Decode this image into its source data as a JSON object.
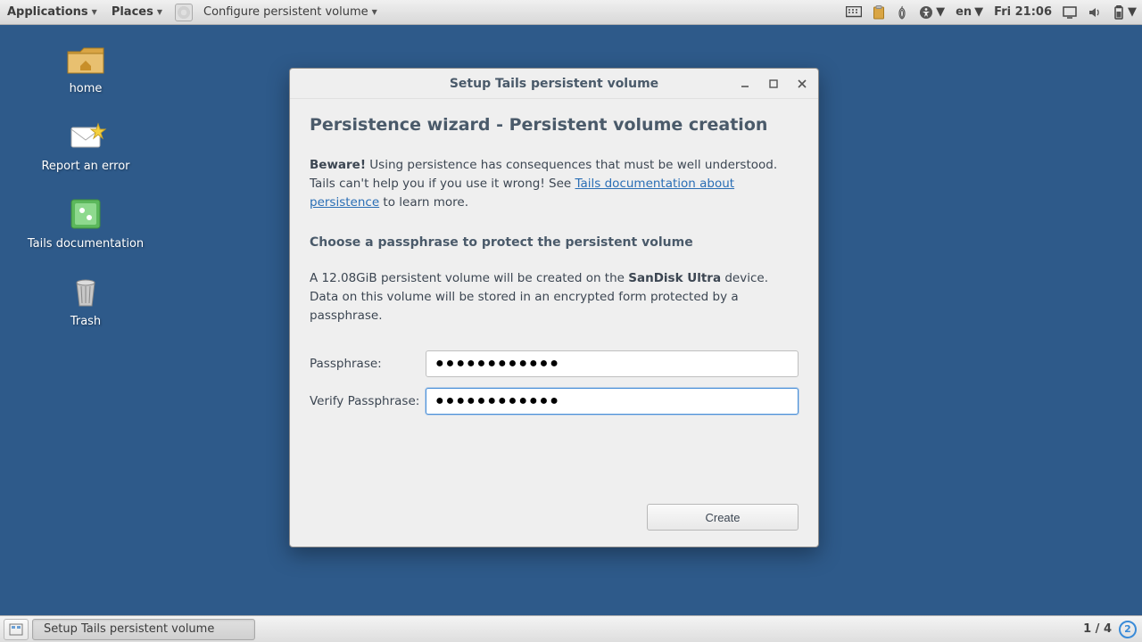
{
  "top_panel": {
    "applications": "Applications",
    "places": "Places",
    "active_app": "Configure persistent volume",
    "lang": "en",
    "clock": "Fri 21:06"
  },
  "desktop": {
    "home": "home",
    "report": "Report an error",
    "docs": "Tails documentation",
    "trash": "Trash"
  },
  "window": {
    "title": "Setup Tails persistent volume",
    "heading": "Persistence wizard - Persistent volume creation",
    "beware_strong": "Beware!",
    "beware_1": " Using persistence has consequences that must be well understood. Tails can't help you if you use it wrong! See ",
    "beware_link": "Tails documentation about persistence",
    "beware_2": " to learn more.",
    "choose": "Choose a passphrase to protect the persistent volume",
    "info_1": "A 12.08GiB persistent volume will be created on the ",
    "info_device": "SanDisk Ultra",
    "info_2": " device. Data on this volume will be stored in an encrypted form protected by a passphrase.",
    "pass_label": "Passphrase:",
    "verify_label": "Verify Passphrase:",
    "pass_value": "●●●●●●●●●●●●",
    "verify_value": "●●●●●●●●●●●●",
    "create": "Create"
  },
  "bottom": {
    "task": "Setup Tails persistent volume",
    "workspace": "1 / 4",
    "badge": "2"
  }
}
